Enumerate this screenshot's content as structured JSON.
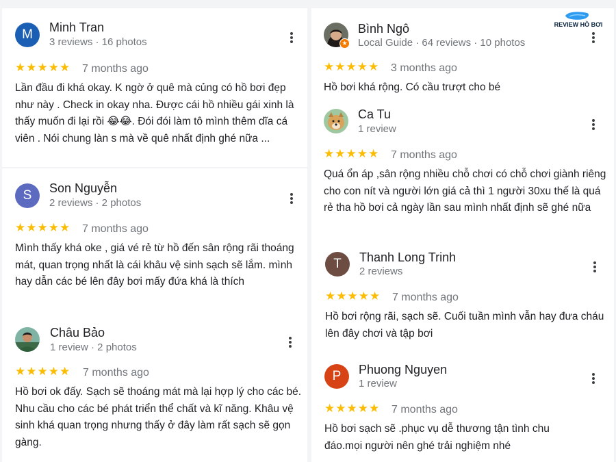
{
  "brand": {
    "logo_text": "REVIEW HỒ BƠI",
    "accent_color": "#2d9bf0"
  },
  "colors": {
    "star": "#fbbc04",
    "meta": "#70757a"
  },
  "reviews": [
    {
      "name": "Minh Tran",
      "meta": "3 reviews · 16 photos",
      "avatar_letter": "M",
      "avatar_color": "#1a5fb4",
      "rating": "★★★★★",
      "time": "7 months ago",
      "text": "Lần đầu đi khá okay. K ngờ ở quê mà củng có hồ bơi đẹp như này . Check in okay nha. Được cái hồ nhiều gái xinh là thấy muốn đi lại rồi 😂😂. Đói đói làm tô mình thêm dĩa cá viên . Nói chung làn s mà về quê nhất định ghé nữa ..."
    },
    {
      "name": "Son Nguyễn",
      "meta": "2 reviews · 2 photos",
      "avatar_letter": "S",
      "avatar_color": "#5c6bc0",
      "rating": "★★★★★",
      "time": "7 months ago",
      "text": "Mình thấy khá oke , giá vé rẻ từ hồ đến sân rộng rãi thoáng mát, quan trọng nhất là cái khâu vệ sinh sạch sẽ lắm. mình hay dẫn các bé lên đây bơi mấy đứa khá là thích"
    },
    {
      "name": "Châu Bảo",
      "meta": "1 review · 2 photos",
      "avatar_icon": "person-photo-icon",
      "rating": "★★★★★",
      "time": "7 months ago",
      "text": "Hồ bơi ok đấy. Sạch sẽ thoáng mát mà lại hợp lý cho các bé. Nhu cầu cho các bé phát triển thể chất và kĩ năng. Khâu vệ sinh khá quan trọng nhưng thấy ở đây làm rất sạch sẽ gọn gàng."
    },
    {
      "name": "Bình Ngô",
      "meta": "Local Guide · 64 reviews · 10 photos",
      "avatar_icon": "person-photo-icon",
      "badge_icon": "local-guide-star-icon",
      "rating": "★★★★★",
      "time": "3 months ago",
      "text": "Hồ bơi khá rộng. Có cầu trượt cho bé"
    },
    {
      "name": "Ca Tu",
      "meta": "1 review",
      "avatar_icon": "dog-photo-icon",
      "rating": "★★★★★",
      "time": "7 months ago",
      "text": "Quá ổn áp ,sân rộng nhiều chỗ chơi có chỗ chơi giành riêng cho con nít và người lớn giá cả thì 1 người 30xu thế là quá rẻ tha hồ bơi cả ngày lần sau mình nhất định sẽ ghé nữa"
    },
    {
      "name": "Thanh Long Trinh",
      "meta": "2 reviews",
      "avatar_letter": "T",
      "avatar_color": "#6d4c41",
      "rating": "★★★★★",
      "time": "7 months ago",
      "text": "Hồ bơi rộng rãi, sạch sẽ. Cuối tuần mình vẫn hay đưa cháu lên đây chơi và tập bơi"
    },
    {
      "name": "Phuong Nguyen",
      "meta": "1 review",
      "avatar_letter": "P",
      "avatar_color": "#d84315",
      "rating": "★★★★★",
      "time": "7 months ago",
      "text": "Hồ bơi sạch sẽ .phục vụ dễ thương tận tình chu đáo.mọi người nên ghé trải nghiệm nhé"
    }
  ]
}
